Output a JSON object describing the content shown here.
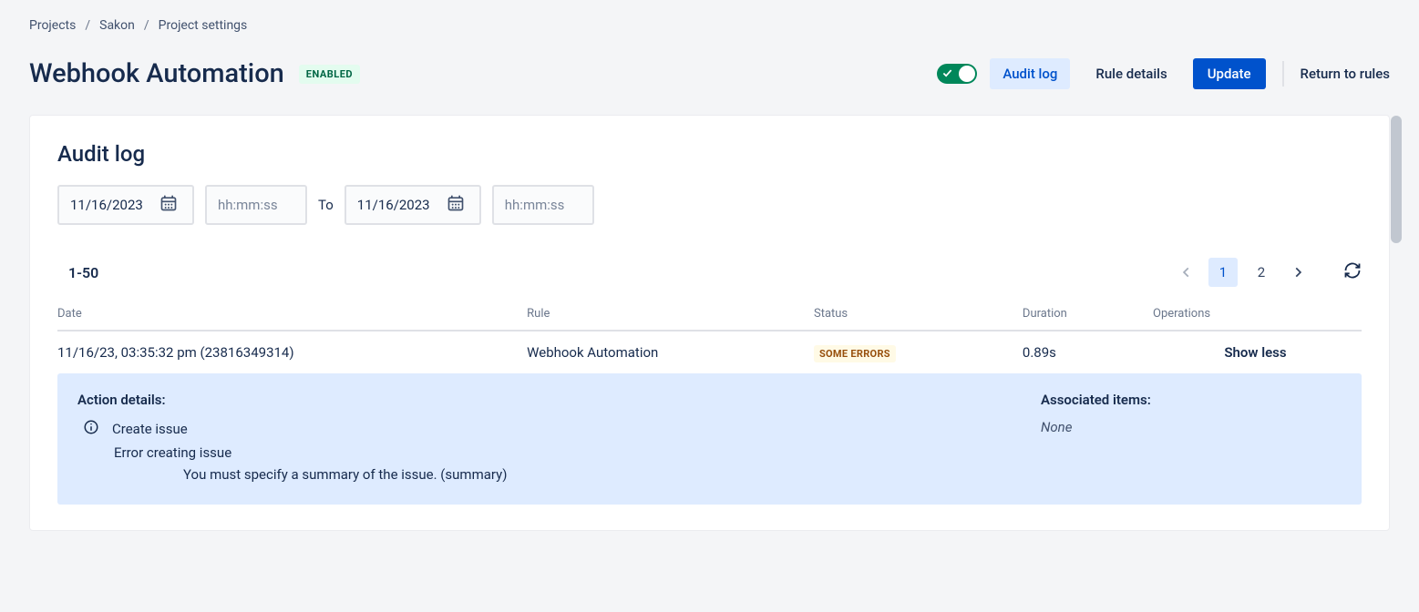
{
  "breadcrumbs": {
    "item0": "Projects",
    "item1": "Sakon",
    "item2": "Project settings"
  },
  "header": {
    "title": "Webhook Automation",
    "status_badge": "ENABLED",
    "tab_audit": "Audit log",
    "tab_rule": "Rule details",
    "btn_update": "Update",
    "btn_return": "Return to rules"
  },
  "audit": {
    "title": "Audit log",
    "from_date": "11/16/2023",
    "from_time_ph": "hh:mm:ss",
    "to_label": "To",
    "to_date": "11/16/2023",
    "to_time_ph": "hh:mm:ss",
    "range_from": "1",
    "range_to": "50",
    "pages": {
      "p1": "1",
      "p2": "2"
    },
    "columns": {
      "date": "Date",
      "rule": "Rule",
      "status": "Status",
      "duration": "Duration",
      "operations": "Operations"
    },
    "row0": {
      "date": "11/16/23, 03:35:32 pm (23816349314)",
      "rule": "Webhook Automation",
      "status": "SOME ERRORS",
      "duration": "0.89s",
      "op": "Show less"
    },
    "details": {
      "header": "Action details:",
      "action": "Create issue",
      "error": "Error creating issue",
      "message": "You must specify a summary of the issue. (summary)",
      "assoc_header": "Associated items:",
      "assoc_value": "None"
    }
  }
}
